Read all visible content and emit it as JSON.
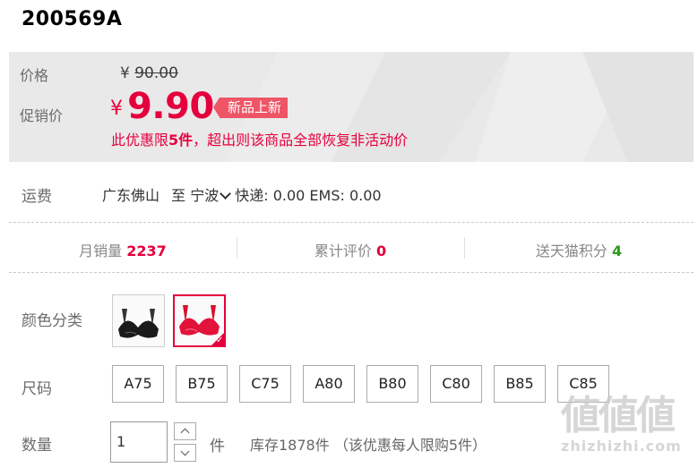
{
  "product": {
    "title": "200569A"
  },
  "price": {
    "label": "价格",
    "currency": "¥",
    "original": "90.00",
    "promo_label": "促销价",
    "promo_currency": "¥",
    "promo": "9.90",
    "tag": "新品上新",
    "limit_pre": "此优惠限",
    "limit_num": "5件",
    "limit_post": "，超出则该商品全部恢复非活动价"
  },
  "shipping": {
    "label": "运费",
    "from": "广东佛山",
    "to_word": "至",
    "dest": "宁波",
    "detail": "快递: 0.00 EMS: 0.00"
  },
  "stats": {
    "sales_label": "月销量",
    "sales_value": "2237",
    "reviews_label": "累计评价",
    "reviews_value": "0",
    "points_label": "送天猫积分",
    "points_value": "4"
  },
  "color": {
    "label": "颜色分类",
    "selected_index": 1
  },
  "size": {
    "label": "尺码",
    "options": [
      "A75",
      "B75",
      "C75",
      "A80",
      "B80",
      "C80",
      "B85",
      "C85"
    ]
  },
  "quantity": {
    "label": "数量",
    "value": "1",
    "unit": "件",
    "stock": "库存1878件",
    "limit_note": "（该优惠每人限购5件）"
  },
  "watermark": {
    "text": "zhizhizhi.com"
  },
  "colors": {
    "accent": "#e5003d",
    "tag_bg": "#ee5566",
    "points_green": "#2b9b19",
    "panel_bg": "#e9e9e9"
  }
}
